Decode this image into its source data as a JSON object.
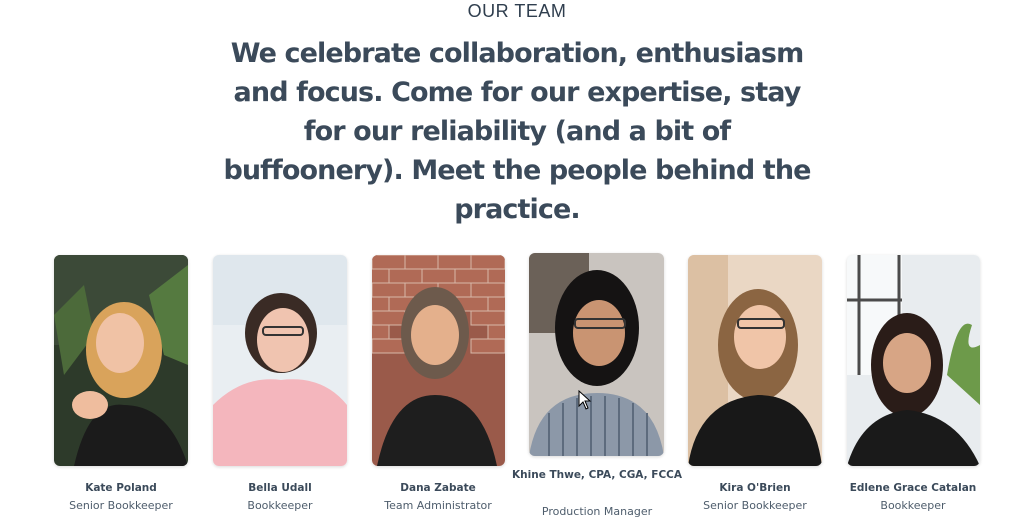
{
  "section": {
    "eyebrow": "OUR TEAM",
    "headline": "We celebrate collaboration, enthusiasm and focus. Come for our expertise, stay for our reliability (and a bit of buffoonery). Meet the people behind the practice."
  },
  "team": [
    {
      "name": "Kate Poland",
      "role": "Senior Bookkeeper"
    },
    {
      "name": "Bella Udall",
      "role": "Bookkeeper"
    },
    {
      "name": "Dana Zabate",
      "role": "Team Administrator"
    },
    {
      "name": "Khine Thwe, CPA, CGA, FCCA",
      "role": "Production Manager"
    },
    {
      "name": "Kira O'Brien",
      "role": "Senior Bookkeeper"
    },
    {
      "name": "Edlene Grace Catalan",
      "role": "Bookkeeper"
    }
  ],
  "colors": {
    "text": "#2f3e4e",
    "headline": "#3b4a5a"
  }
}
